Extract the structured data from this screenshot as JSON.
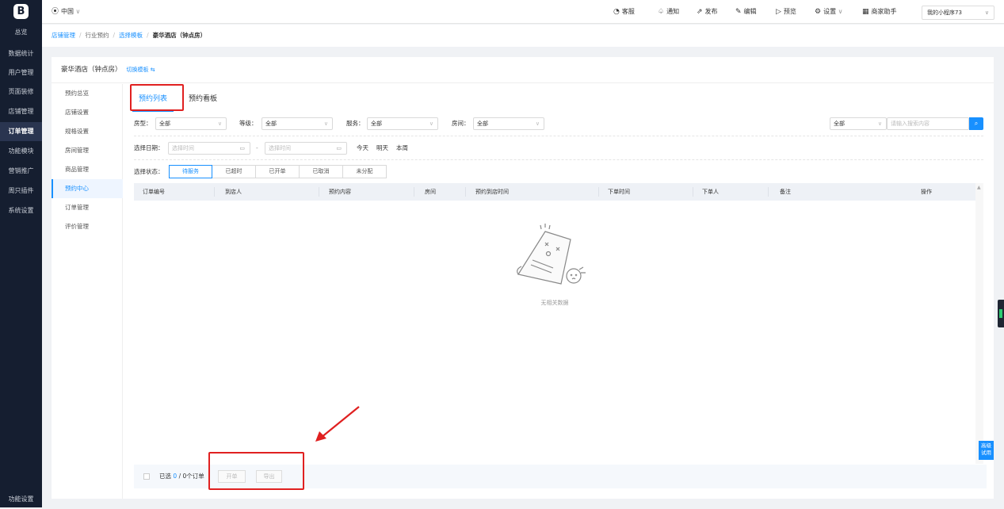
{
  "sidebar": {
    "logo": "B",
    "items": [
      "总览",
      "数据统计",
      "用户管理",
      "页面装修",
      "店铺管理",
      "订单管理",
      "功能模块",
      "营销推广",
      "周只插件",
      "系统设置"
    ],
    "active_index": 5,
    "bottom": "功能设置"
  },
  "topbar": {
    "location": "中国",
    "service": "客服",
    "notice": "通知",
    "publish": "发布",
    "edit": "编辑",
    "preview": "预览",
    "settings": "设置",
    "assistant": "商家助手",
    "mini_program": "我的小程序73"
  },
  "breadcrumb": {
    "items": [
      "店铺管理",
      "行业预约",
      "选择模板"
    ],
    "current": "豪华酒店（钟点房）"
  },
  "card": {
    "title": "豪华酒店（钟点房）",
    "switch_label": "切换模板 ⇆"
  },
  "left_nav": {
    "items": [
      "预约总览",
      "店铺设置",
      "规格设置",
      "房间管理",
      "商品管理",
      "预约中心",
      "订单管理",
      "评价管理"
    ],
    "active_index": 5
  },
  "tabs": {
    "list": "预约列表",
    "board": "预约看板"
  },
  "filters": {
    "room_type_label": "房型：",
    "room_type_value": "全部",
    "grade_label": "等级：",
    "grade_value": "全部",
    "service_label": "服务：",
    "service_value": "全部",
    "room_label": "房间：",
    "room_value": "全部",
    "search_scope": "全部",
    "search_placeholder": "请输入搜索内容",
    "date_label": "选择日期：",
    "date_start_placeholder": "选择时间",
    "date_sep": "-",
    "date_end_placeholder": "选择时间",
    "today": "今天",
    "tomorrow": "明天",
    "this_week": "本周",
    "status_label": "选择状态：",
    "statuses": [
      "待服务",
      "已超时",
      "已开单",
      "已取消",
      "未分配"
    ],
    "active_status": 0
  },
  "table": {
    "columns": [
      "订单编号",
      "到店人",
      "预约内容",
      "房间",
      "预约到店时间",
      "下单时间",
      "下单人",
      "备注",
      "操作"
    ],
    "empty_text": "无相关数据"
  },
  "footer": {
    "selected_prefix": "已选",
    "selected_count": "0",
    "selected_suffix": "/ 0个订单",
    "open_button": "开单",
    "export_button": "导出"
  },
  "advanced": "高级试用",
  "colors": {
    "accent": "#1890ff",
    "sidebar_bg": "#151e30",
    "highlight_red": "#e02020"
  }
}
